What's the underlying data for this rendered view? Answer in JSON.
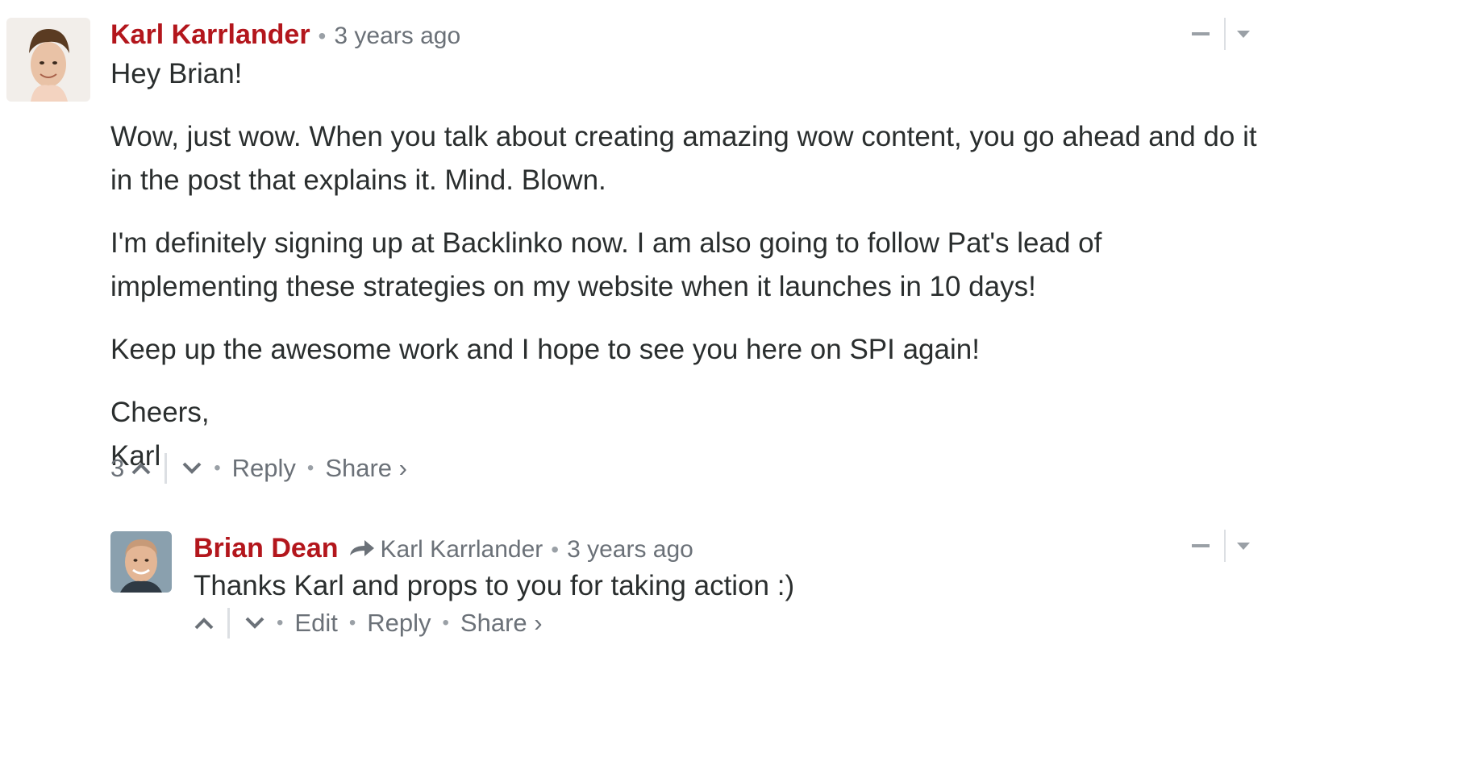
{
  "comments": [
    {
      "author": "Karl Karrlander",
      "time": "3 years ago",
      "avatar_icon": "user-photo",
      "paragraphs": [
        "Hey Brian!",
        "Wow, just wow. When you talk about creating amazing wow content, you go ahead and do it in the post that explains it. Mind. Blown.",
        "I'm definitely signing up at Backlinko now. I am also going to follow Pat's lead of implementing these strategies on my website when it launches in 10 days!",
        "Keep up the awesome work and I hope to see you here on SPI again!"
      ],
      "signoff": [
        "Cheers,",
        "Karl"
      ],
      "votes": "3",
      "reply_label": "Reply",
      "share_label": "Share ›"
    },
    {
      "author": "Brian Dean",
      "in_reply_to": "Karl Karrlander",
      "time": "3 years ago",
      "avatar_icon": "user-photo",
      "text": "Thanks Karl and props to you for taking action :)",
      "edit_label": "Edit",
      "reply_label": "Reply",
      "share_label": "Share ›"
    }
  ],
  "colors": {
    "author": "#b3161c",
    "meta": "#6b7178",
    "text": "#2a2e2e"
  }
}
